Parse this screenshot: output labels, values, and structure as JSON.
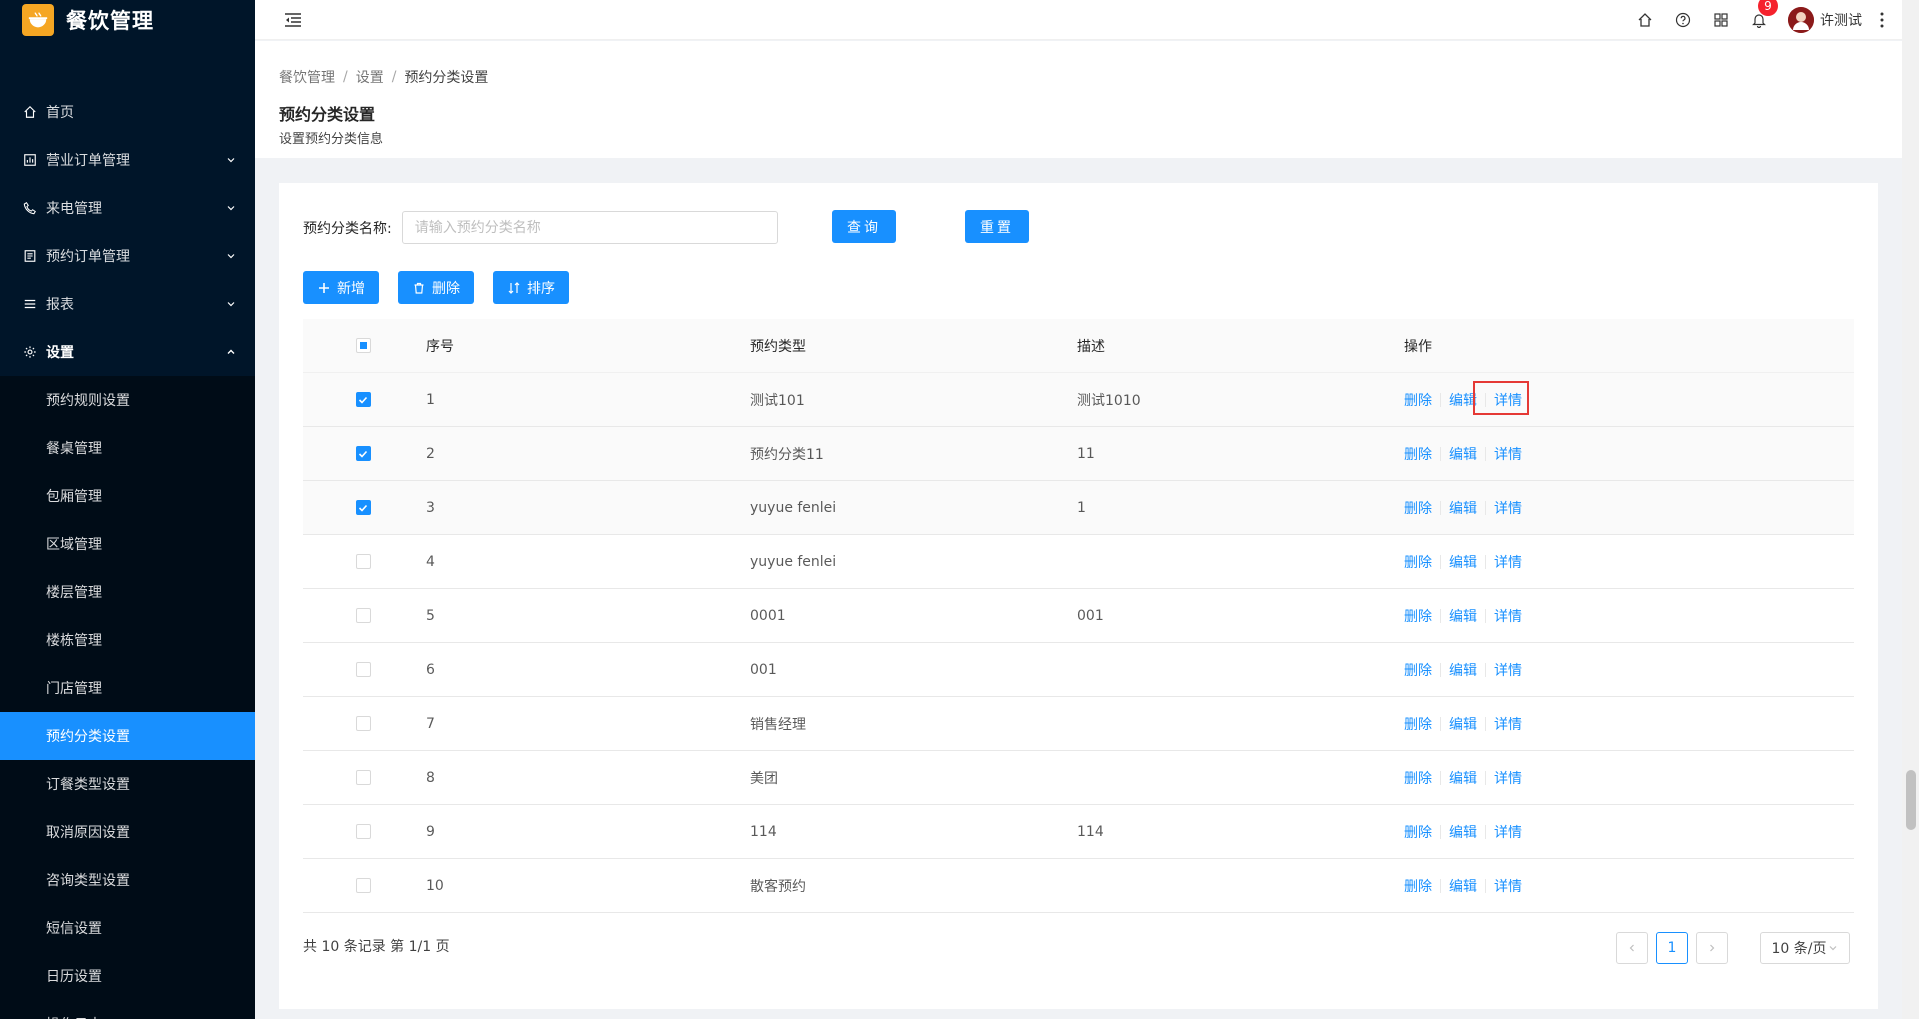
{
  "app": {
    "title": "餐饮管理"
  },
  "sidebar": {
    "items": [
      {
        "label": "首页",
        "icon": "home-icon"
      },
      {
        "label": "营业订单管理",
        "icon": "order-icon"
      },
      {
        "label": "来电管理",
        "icon": "phone-icon"
      },
      {
        "label": "预约订单管理",
        "icon": "reservation-icon"
      },
      {
        "label": "报表",
        "icon": "report-icon"
      },
      {
        "label": "设置",
        "icon": "gear-icon"
      }
    ],
    "sub_items": [
      "预约规则设置",
      "餐桌管理",
      "包厢管理",
      "区域管理",
      "楼层管理",
      "楼栋管理",
      "门店管理",
      "预约分类设置",
      "订餐类型设置",
      "取消原因设置",
      "咨询类型设置",
      "短信设置",
      "日历设置",
      "操作日志"
    ],
    "active_sub": "预约分类设置"
  },
  "header": {
    "notification_count": "9",
    "user_name": "许测试"
  },
  "breadcrumb": [
    "餐饮管理",
    "设置",
    "预约分类设置"
  ],
  "page": {
    "title": "预约分类设置",
    "description": "设置预约分类信息"
  },
  "search": {
    "label": "预约分类名称:",
    "placeholder": "请输入预约分类名称",
    "value": "",
    "query_label": "查询",
    "reset_label": "重置"
  },
  "toolbar": {
    "add_label": "新增",
    "delete_label": "删除",
    "sort_label": "排序"
  },
  "table": {
    "columns": [
      "序号",
      "预约类型",
      "描述",
      "操作"
    ],
    "rows": [
      {
        "no": "1",
        "type": "测试101",
        "desc": "测试1010",
        "checked": true
      },
      {
        "no": "2",
        "type": "预约分类11",
        "desc": "11",
        "checked": true
      },
      {
        "no": "3",
        "type": "yuyue fenlei",
        "desc": "1",
        "checked": true
      },
      {
        "no": "4",
        "type": "yuyue fenlei",
        "desc": "",
        "checked": false
      },
      {
        "no": "5",
        "type": "0001",
        "desc": "001",
        "checked": false
      },
      {
        "no": "6",
        "type": "001",
        "desc": "",
        "checked": false
      },
      {
        "no": "7",
        "type": "销售经理",
        "desc": "",
        "checked": false
      },
      {
        "no": "8",
        "type": "美团",
        "desc": "",
        "checked": false
      },
      {
        "no": "9",
        "type": "114",
        "desc": "114",
        "checked": false
      },
      {
        "no": "10",
        "type": "散客预约",
        "desc": "",
        "checked": false
      }
    ],
    "ops": {
      "delete": "删除",
      "edit": "编辑",
      "detail": "详情"
    }
  },
  "pagination": {
    "total_text": "共 10 条记录 第 1/1 页",
    "current_page": "1",
    "page_size": "10 条/页"
  },
  "colors": {
    "sidebar_bg": "#001529",
    "primary": "#1890ff",
    "highlight": "#e53935",
    "badge": "#f5222d"
  }
}
